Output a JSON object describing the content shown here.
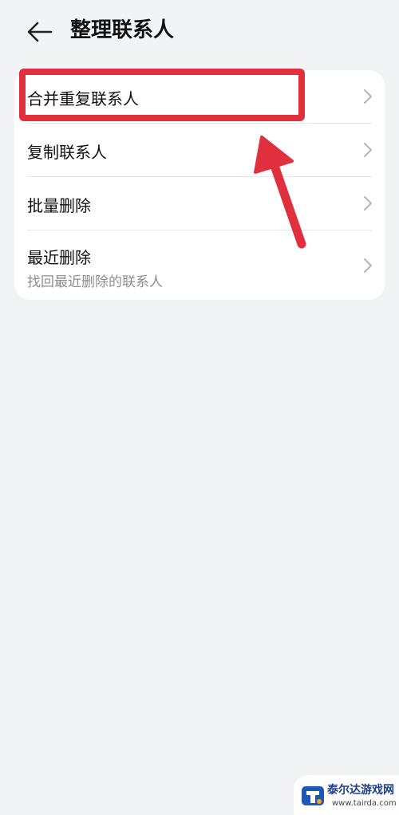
{
  "header": {
    "title": "整理联系人"
  },
  "menu": {
    "items": [
      {
        "label": "合并重复联系人"
      },
      {
        "label": "复制联系人"
      },
      {
        "label": "批量删除"
      },
      {
        "label": "最近删除",
        "subtitle": "找回最近删除的联系人"
      }
    ]
  },
  "annotation": {
    "color": "#e0303e"
  },
  "watermark": {
    "name": "泰尔达游戏网",
    "url": "www.tairda.com"
  },
  "icons": {
    "back": "back-arrow-icon",
    "chevron": "chevron-right-icon"
  }
}
